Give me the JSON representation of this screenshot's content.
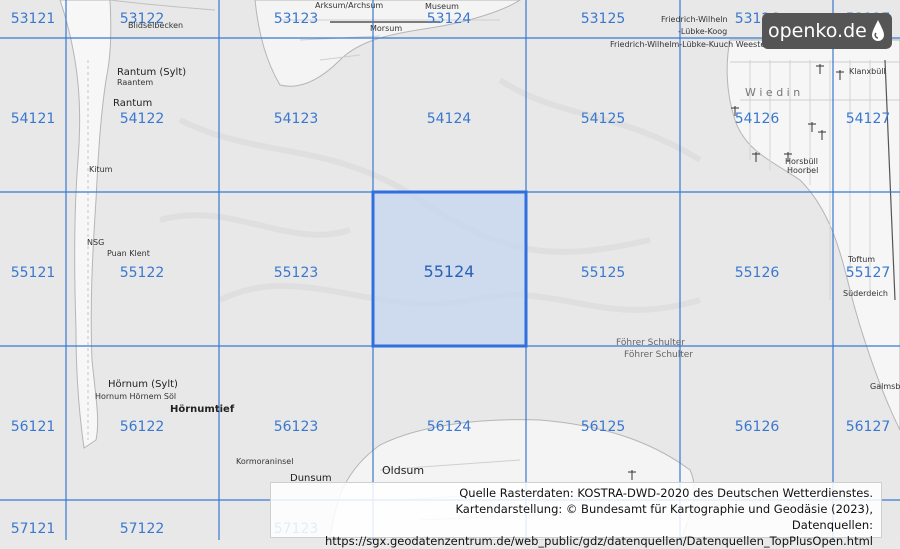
{
  "grid": {
    "rows": [
      [
        "53121",
        "53122",
        "53123",
        "53124",
        "53125",
        "53126",
        "53127"
      ],
      [
        "54121",
        "54122",
        "54123",
        "54124",
        "54125",
        "54126",
        "54127"
      ],
      [
        "55121",
        "55122",
        "55123",
        "55124",
        "55125",
        "55126",
        "55127"
      ],
      [
        "56121",
        "56122",
        "56123",
        "56124",
        "56125",
        "56126",
        "56127"
      ],
      [
        "57121",
        "57122",
        "57123",
        "",
        "",
        "",
        ""
      ]
    ],
    "selected": "55124",
    "line_color": "#3a78d0",
    "selected_fill": "#c9d7ef",
    "selected_stroke": "#2f6fe0"
  },
  "places": {
    "rantum": "Rantum (Sylt)",
    "raantem": "Raantem",
    "rantum2": "Rantum",
    "keitum": "Kitum",
    "puan_klent": "Puan Klent",
    "nsg": "NSG",
    "hoernum": "Hörnum (Sylt)",
    "hoernum_sol": "Hornum Hörnem Söl",
    "hoernumtief": "Hörnumtief",
    "kormoraninsel": "Kormoraninsel",
    "dunsum": "Dunsum",
    "oldsum": "Oldsum",
    "morsum": "Morsum",
    "arksum": "Arksum/Archsum",
    "museum": "Museum",
    "fwk_top": "Friedrich-Wilheln",
    "luebke_koog": "-Lübke-Koog",
    "fwk_line": "Friedrich-Wilhelm-Lübke-Kuuch Weester Klangsbe",
    "klanxbuell": "Klanxbüll",
    "wiedin": "W i e d i n",
    "horsbuell": "Horsbüll",
    "hoorbel": "Hoorbel",
    "toftum": "Toftum",
    "suederdeich": "Süderdeich",
    "galmsbuell": "Galmsb",
    "foehrer_schulter_1": "Föhrer Schulter",
    "foehrer_schulter_2": "Föhrer Schulter",
    "haekken": "Blidselbecken"
  },
  "logo": {
    "text": "openko.de"
  },
  "attribution": {
    "line1": "Quelle Rasterdaten: KOSTRA-DWD-2020 des Deutschen Wetterdienstes.",
    "line2": "Kartendarstellung: © Bundesamt für Kartographie und Geodäsie (2023),",
    "line3": "Datenquellen: https://sgx.geodatenzentrum.de/web_public/gdz/datenquellen/Datenquellen_TopPlusOpen.html"
  }
}
